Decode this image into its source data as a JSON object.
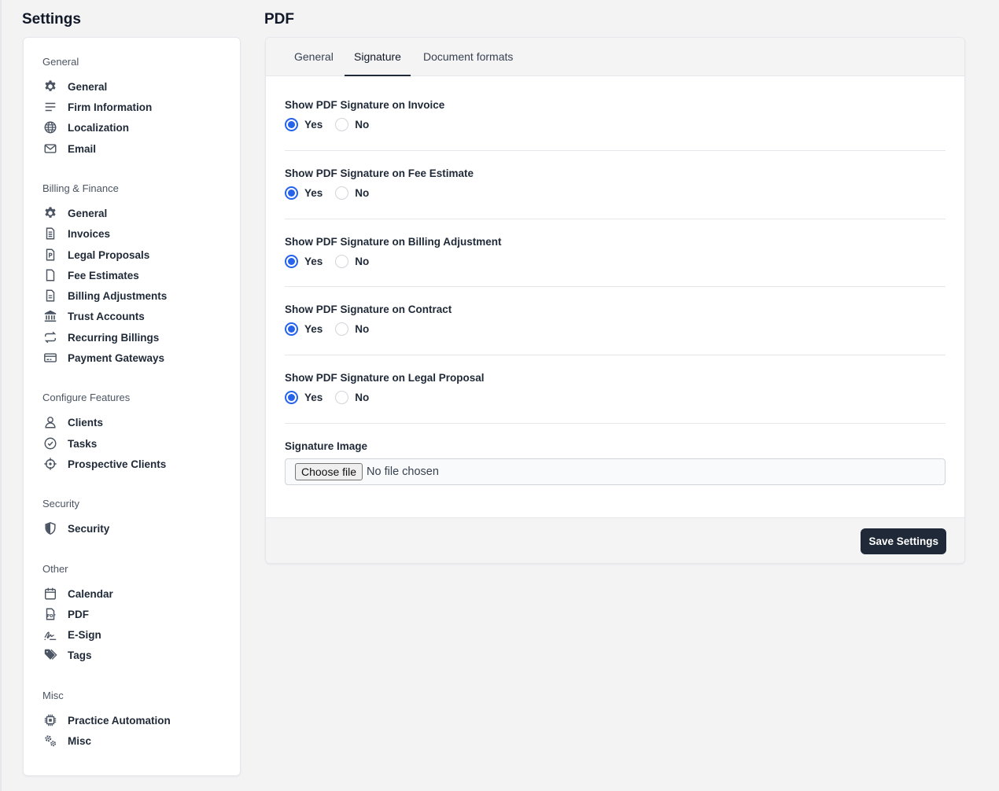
{
  "header": {
    "settings_title": "Settings",
    "page_title": "PDF"
  },
  "sidebar": {
    "sections": [
      {
        "title": "General",
        "items": [
          {
            "label": "General",
            "icon": "gear-icon"
          },
          {
            "label": "Firm Information",
            "icon": "lines-icon"
          },
          {
            "label": "Localization",
            "icon": "globe-icon"
          },
          {
            "label": "Email",
            "icon": "envelope-icon"
          }
        ]
      },
      {
        "title": "Billing & Finance",
        "items": [
          {
            "label": "General",
            "icon": "gear-icon"
          },
          {
            "label": "Invoices",
            "icon": "invoice-icon"
          },
          {
            "label": "Legal Proposals",
            "icon": "proposal-icon"
          },
          {
            "label": "Fee Estimates",
            "icon": "document-icon"
          },
          {
            "label": "Billing Adjustments",
            "icon": "document-lines-icon"
          },
          {
            "label": "Trust Accounts",
            "icon": "bank-icon"
          },
          {
            "label": "Recurring Billings",
            "icon": "repeat-icon"
          },
          {
            "label": "Payment Gateways",
            "icon": "credit-card-icon"
          }
        ]
      },
      {
        "title": "Configure Features",
        "items": [
          {
            "label": "Clients",
            "icon": "user-icon"
          },
          {
            "label": "Tasks",
            "icon": "check-circle-icon"
          },
          {
            "label": "Prospective Clients",
            "icon": "crosshair-icon"
          }
        ]
      },
      {
        "title": "Security",
        "items": [
          {
            "label": "Security",
            "icon": "shield-icon"
          }
        ]
      },
      {
        "title": "Other",
        "items": [
          {
            "label": "Calendar",
            "icon": "calendar-icon"
          },
          {
            "label": "PDF",
            "icon": "pdf-icon"
          },
          {
            "label": "E-Sign",
            "icon": "signature-icon"
          },
          {
            "label": "Tags",
            "icon": "tags-icon"
          }
        ]
      },
      {
        "title": "Misc",
        "items": [
          {
            "label": "Practice Automation",
            "icon": "chip-icon"
          },
          {
            "label": "Misc",
            "icon": "gears-icon"
          }
        ]
      }
    ]
  },
  "tabs": [
    {
      "label": "General",
      "active": false
    },
    {
      "label": "Signature",
      "active": true
    },
    {
      "label": "Document formats",
      "active": false
    }
  ],
  "fields": [
    {
      "label": "Show PDF Signature on Invoice",
      "yes": "Yes",
      "no": "No",
      "value": "Yes"
    },
    {
      "label": "Show PDF Signature on Fee Estimate",
      "yes": "Yes",
      "no": "No",
      "value": "Yes"
    },
    {
      "label": "Show PDF Signature on Billing Adjustment",
      "yes": "Yes",
      "no": "No",
      "value": "Yes"
    },
    {
      "label": "Show PDF Signature on Contract",
      "yes": "Yes",
      "no": "No",
      "value": "Yes"
    },
    {
      "label": "Show PDF Signature on Legal Proposal",
      "yes": "Yes",
      "no": "No",
      "value": "Yes"
    }
  ],
  "signature_image": {
    "label": "Signature Image",
    "button": "Choose file",
    "status": "No file chosen"
  },
  "footer": {
    "save_label": "Save Settings"
  },
  "colors": {
    "accent": "#2563eb",
    "dark_button": "#1f2937",
    "background": "#f3f3f4"
  }
}
